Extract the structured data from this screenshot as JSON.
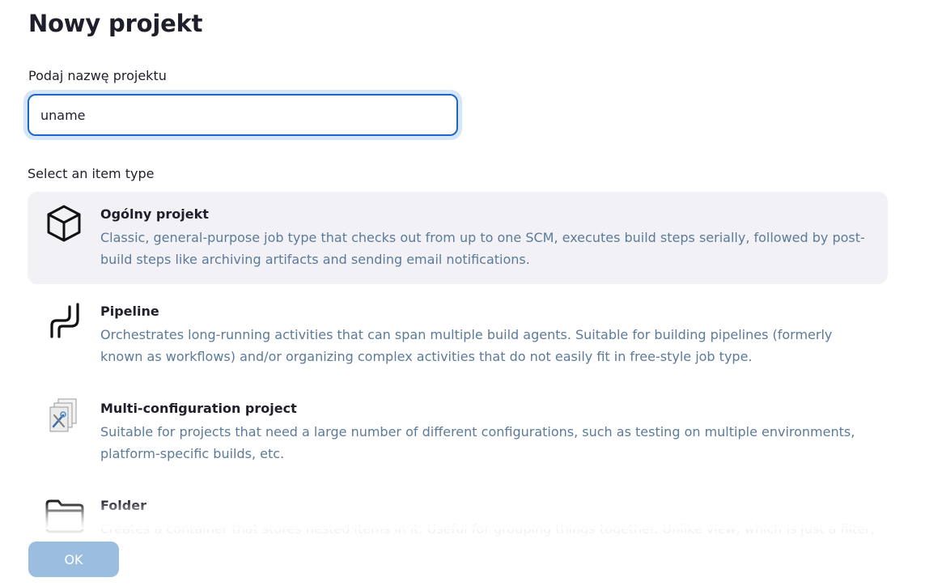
{
  "page": {
    "title": "Nowy projekt"
  },
  "name_field": {
    "label": "Podaj nazwę projektu",
    "value": "uname"
  },
  "item_types": {
    "label": "Select an item type",
    "items": [
      {
        "name": "Ogólny projekt",
        "description": "Classic, general-purpose job type that checks out from up to one SCM, executes build steps serially, followed by post-build steps like archiving artifacts and sending email notifications.",
        "icon": "package-box-icon",
        "selected": true
      },
      {
        "name": "Pipeline",
        "description": "Orchestrates long-running activities that can span multiple build agents. Suitable for building pipelines (formerly known as workflows) and/or organizing complex activities that do not easily fit in free-style job type.",
        "icon": "pipeline-icon",
        "selected": false
      },
      {
        "name": "Multi-configuration project",
        "description": "Suitable for projects that need a large number of different configurations, such as testing on multiple environments, platform-specific builds, etc.",
        "icon": "multi-config-icon",
        "selected": false
      },
      {
        "name": "Folder",
        "description": "Creates a container that stores nested items in it. Useful for grouping things together. Unlike view, which is just a filter, a",
        "icon": "folder-icon",
        "selected": false
      }
    ]
  },
  "actions": {
    "ok_label": "OK"
  },
  "colors": {
    "accent": "#1d67c8",
    "description": "#5c7a99",
    "selected_bg": "#f2f2f6",
    "ok_button_bg": "#9bbde0"
  }
}
